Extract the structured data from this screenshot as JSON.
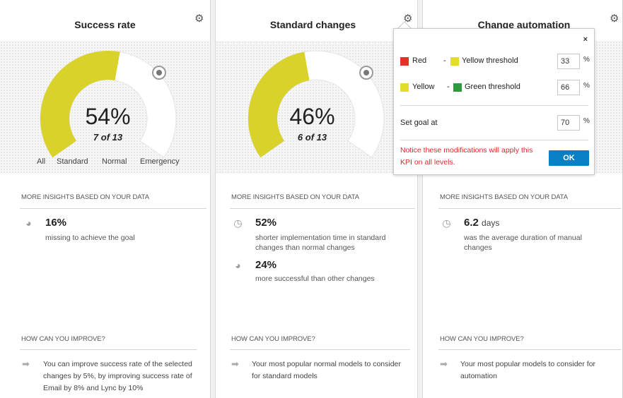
{
  "panels": [
    {
      "title": "Success rate",
      "gauge": {
        "percent_text": "54%",
        "count_text": "7 of 13",
        "value": 0.54
      },
      "categories": [
        "All",
        "Standard",
        "Normal",
        "Emergency"
      ],
      "insights_heading": "MORE INSIGHTS BASED ON YOUR DATA",
      "insights": [
        {
          "icon": "pie-icon",
          "value": "16%",
          "unit": "",
          "desc": "missing to achieve the goal"
        }
      ],
      "improve_heading": "HOW CAN YOU IMPROVE?",
      "improve_text": "You can improve success rate of the selected changes by 5%, by improving success rate of Email by 8% and Lync by 10%"
    },
    {
      "title": "Standard changes",
      "gauge": {
        "percent_text": "46%",
        "count_text": "6 of 13",
        "value": 0.46
      },
      "insights_heading": "MORE INSIGHTS BASED ON YOUR DATA",
      "insights": [
        {
          "icon": "clock-icon",
          "value": "52%",
          "unit": "",
          "desc": "shorter implementation time in standard changes than normal changes"
        },
        {
          "icon": "pie-icon",
          "value": "24%",
          "unit": "",
          "desc": "more successful than other changes"
        }
      ],
      "improve_heading": "HOW CAN YOU IMPROVE?",
      "improve_text": "Your most popular normal models to consider for standard models"
    },
    {
      "title": "Change automation",
      "insights_heading": "MORE INSIGHTS BASED ON YOUR DATA",
      "insights": [
        {
          "icon": "clock-icon",
          "value": "6.2",
          "unit": "days",
          "desc": "was the average duration of manual changes"
        }
      ],
      "improve_heading": "HOW CAN YOU IMPROVE?",
      "improve_text": "Your most popular models to consider for automation"
    }
  ],
  "popup": {
    "close": "×",
    "row1": {
      "from": "Red",
      "dash": "-",
      "to": "Yellow threshold",
      "value": "33",
      "unit": "%"
    },
    "row2": {
      "from": "Yellow",
      "dash": "-",
      "to": "Green threshold",
      "value": "66",
      "unit": "%"
    },
    "goal": {
      "label": "Set goal at",
      "value": "70",
      "unit": "%"
    },
    "notice": "Notice these modifications will apply this KPI on all levels.",
    "ok": "OK"
  },
  "icons": {
    "gear": "gear-icon",
    "improve": "arrow-right-icon"
  },
  "colors": {
    "gauge_fill": "#d8d22a",
    "gauge_track": "#ffffff",
    "red": "#e2332b",
    "yellow": "#e3dc2a",
    "green": "#2e9a3e",
    "ok": "#0a7fc6",
    "notice": "#e0272b"
  }
}
